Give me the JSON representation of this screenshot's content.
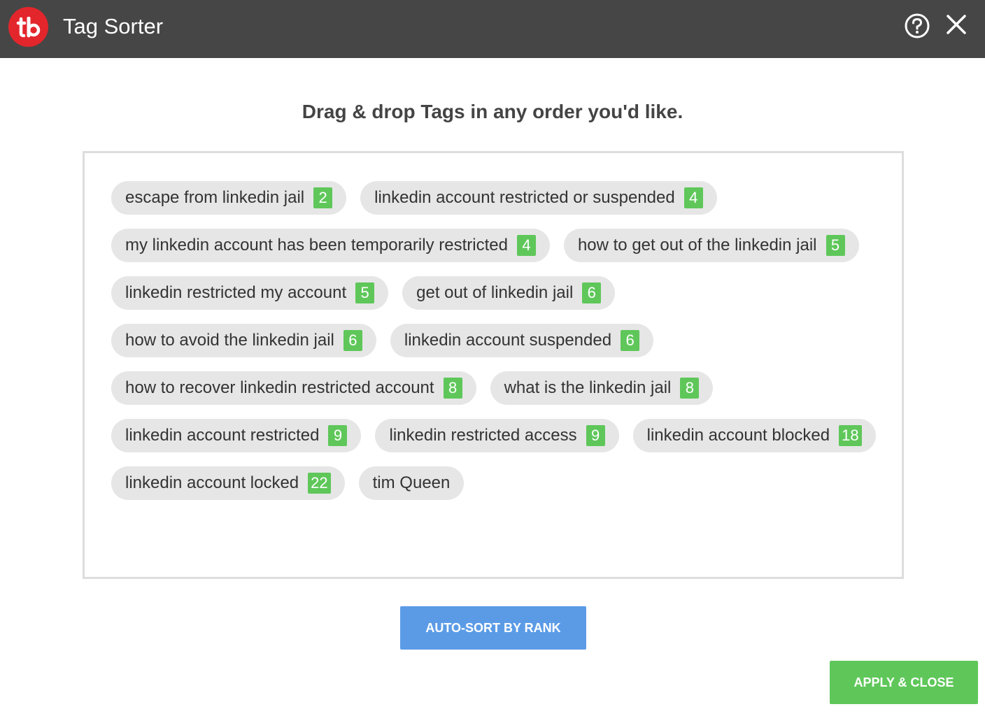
{
  "window": {
    "title": "Tag Sorter",
    "logo_icon": "tubebuddy-logo-icon",
    "help_icon": "help-circle-icon",
    "close_icon": "close-icon"
  },
  "colors": {
    "titlebar": "#464646",
    "logo": "#e3262c",
    "tag_bg": "#e6e6e6",
    "count_badge": "#5fc75a",
    "auto_sort_button": "#5b9be6",
    "apply_button": "#5fc75a"
  },
  "main": {
    "heading": "Drag & drop Tags in any order you'd like."
  },
  "tags": [
    {
      "label": "escape from linkedin jail",
      "count": "2"
    },
    {
      "label": "linkedin account restricted or suspended",
      "count": "4"
    },
    {
      "label": "my linkedin account has been temporarily restricted",
      "count": "4"
    },
    {
      "label": "how to get out of the linkedin jail",
      "count": "5"
    },
    {
      "label": "linkedin restricted my account",
      "count": "5"
    },
    {
      "label": "get out of linkedin jail",
      "count": "6"
    },
    {
      "label": "how to avoid the linkedin jail",
      "count": "6"
    },
    {
      "label": "linkedin account suspended",
      "count": "6"
    },
    {
      "label": "how to recover linkedin restricted account",
      "count": "8"
    },
    {
      "label": "what is the linkedin jail",
      "count": "8"
    },
    {
      "label": "linkedin account restricted",
      "count": "9"
    },
    {
      "label": "linkedin restricted access",
      "count": "9"
    },
    {
      "label": "linkedin account blocked",
      "count": "18"
    },
    {
      "label": "linkedin account locked",
      "count": "22"
    },
    {
      "label": "tim Queen",
      "count": ""
    }
  ],
  "buttons": {
    "auto_sort": "AUTO-SORT BY RANK",
    "apply_close": "APPLY & CLOSE"
  }
}
